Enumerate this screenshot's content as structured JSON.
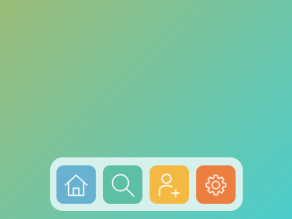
{
  "wallpaper": {
    "gradient_from": "#9cbc78",
    "gradient_to": "#4ccdcc"
  },
  "dock": {
    "background": "#d6f1ec",
    "items": [
      {
        "id": "home",
        "icon": "home-icon",
        "color": "#67b2d0"
      },
      {
        "id": "search",
        "icon": "search-icon",
        "color": "#5dbfa5"
      },
      {
        "id": "add-user",
        "icon": "add-user-icon",
        "color": "#f4b942"
      },
      {
        "id": "settings",
        "icon": "gear-icon",
        "color": "#ec7e3f"
      }
    ]
  }
}
